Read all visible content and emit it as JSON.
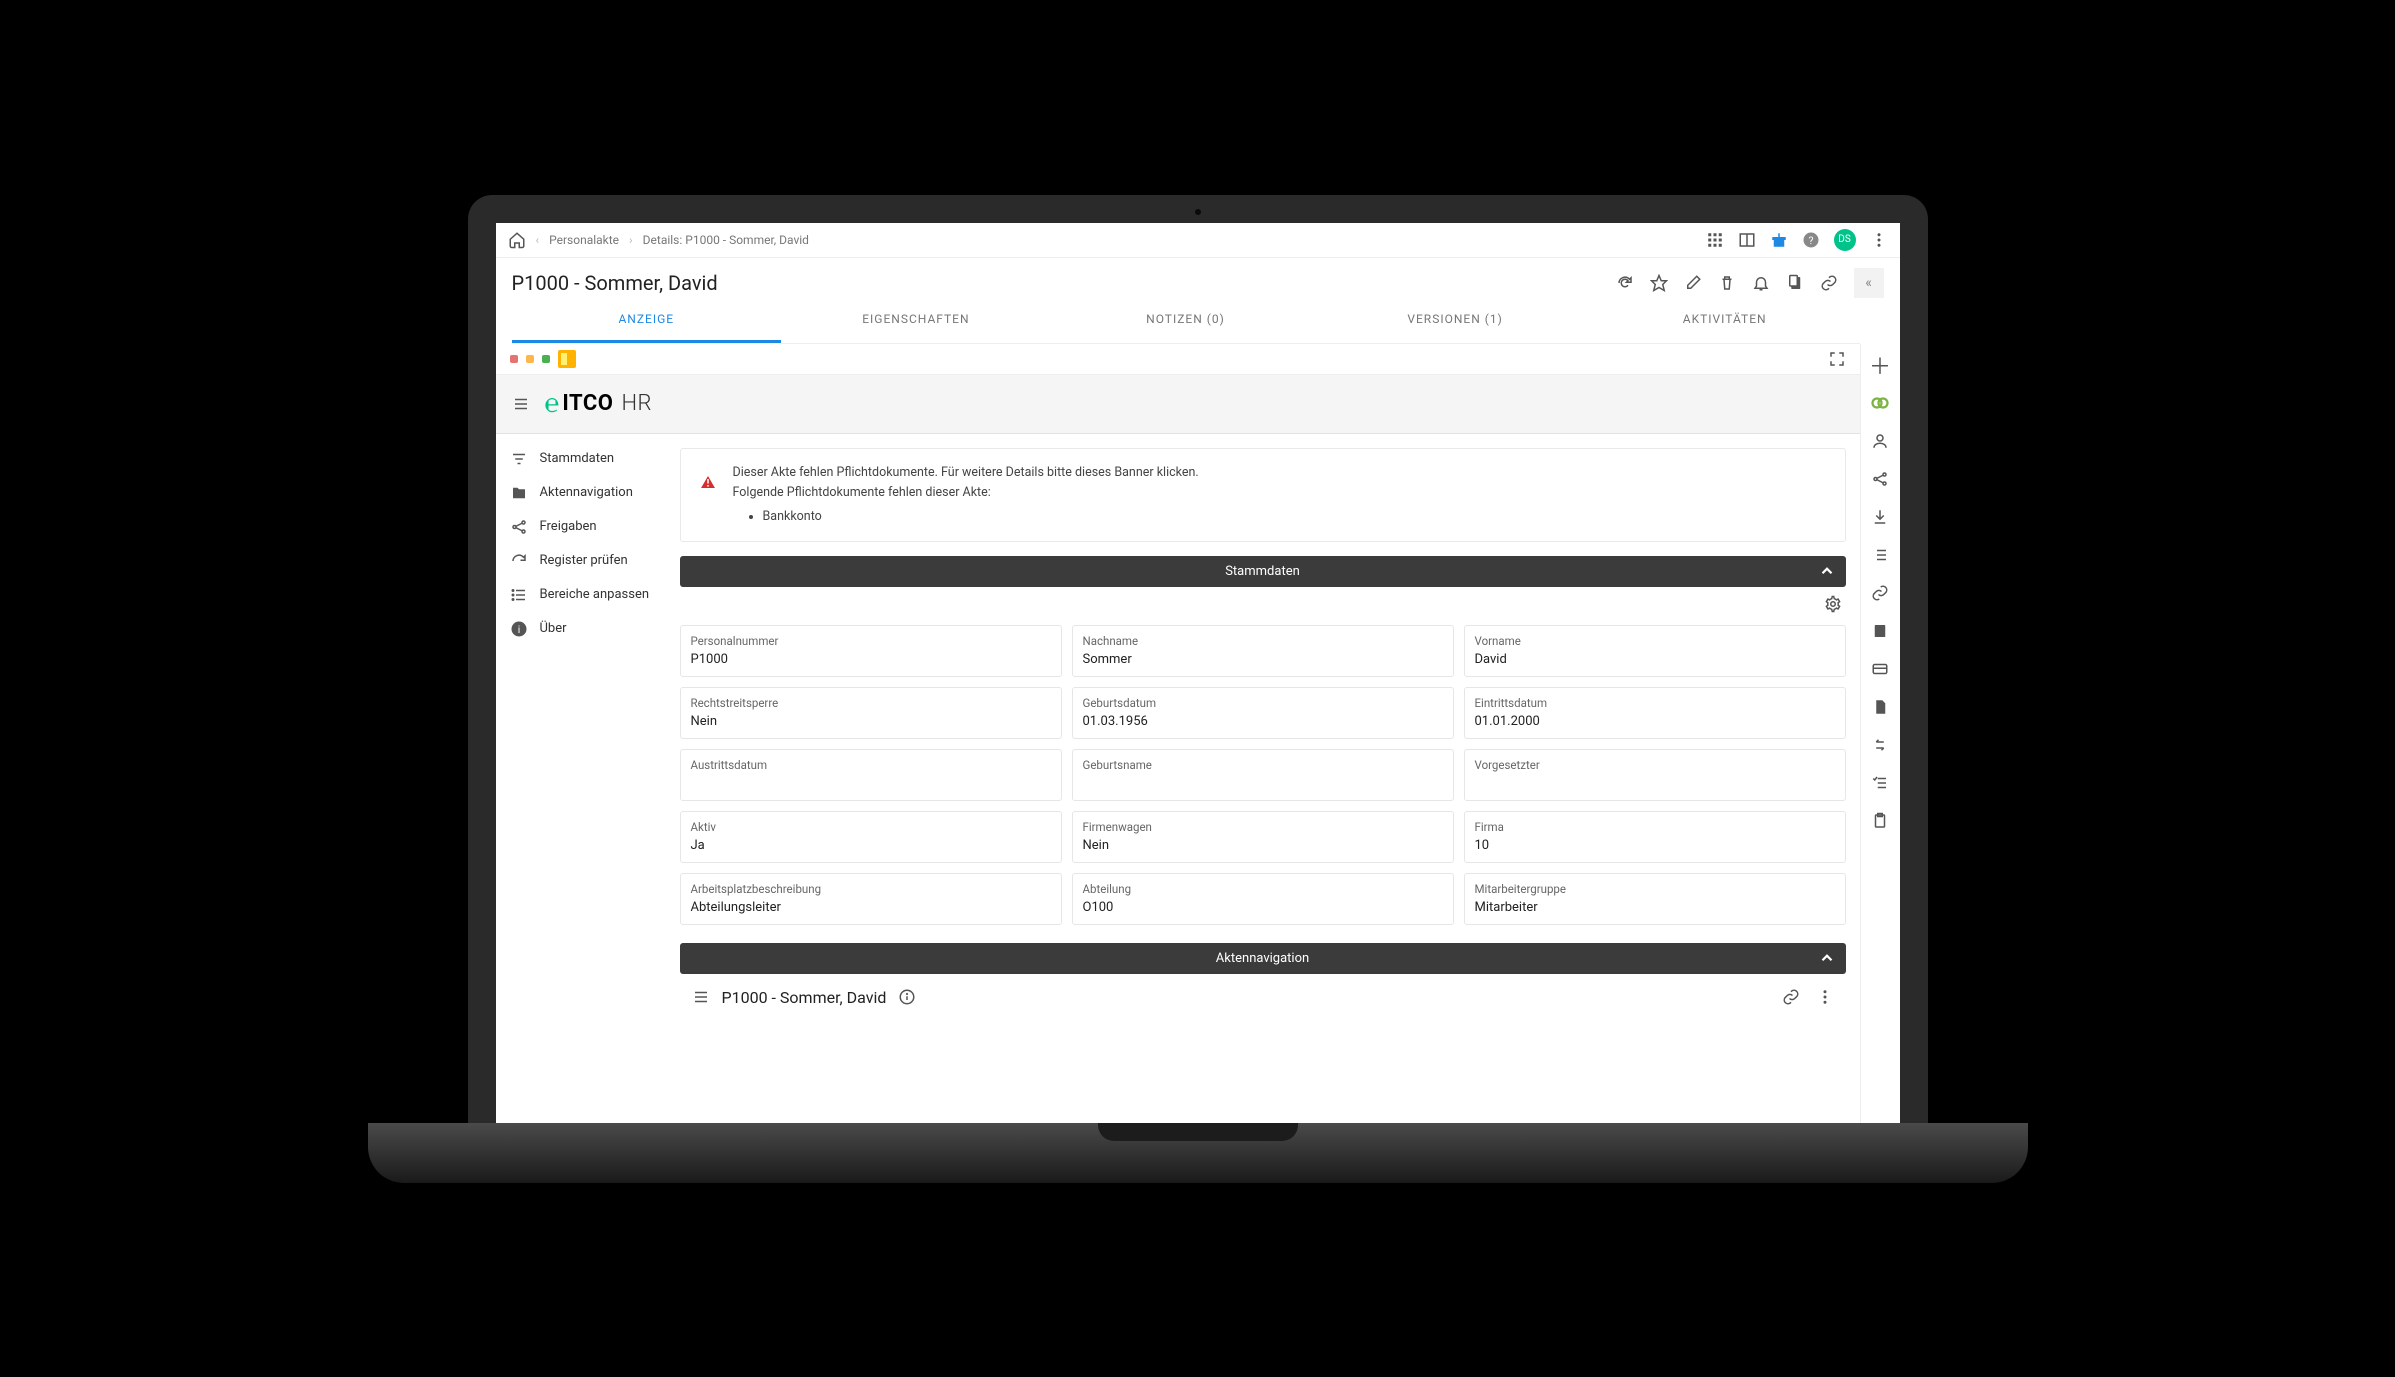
{
  "breadcrumb": {
    "item1": "Personalakte",
    "item2": "Details: P1000 - Sommer, David"
  },
  "header_right": {
    "avatar_initials": "DS"
  },
  "page_title": "P1000 - Sommer, David",
  "tabs": {
    "anzeige": "ANZEIGE",
    "eigenschaften": "EIGENSCHAFTEN",
    "notizen": "NOTIZEN (0)",
    "versionen": "VERSIONEN (1)",
    "aktivitaeten": "AKTIVITÄTEN"
  },
  "logo": {
    "brand": "ITCO",
    "suffix": "HR"
  },
  "sidenav": {
    "stammdaten": "Stammdaten",
    "aktennavigation": "Aktennavigation",
    "freigaben": "Freigaben",
    "register_pruefen": "Register prüfen",
    "bereiche_anpassen": "Bereiche anpassen",
    "ueber": "Über"
  },
  "banner": {
    "line1": "Dieser Akte fehlen Pflichtdokumente. Für weitere Details bitte dieses Banner klicken.",
    "line2": "Folgende Pflichtdokumente fehlen dieser Akte:",
    "missing_item": "Bankkonto"
  },
  "section_stammdaten": "Stammdaten",
  "section_aktennav": "Aktennavigation",
  "fields": {
    "personalnummer": {
      "label": "Personalnummer",
      "value": "P1000"
    },
    "nachname": {
      "label": "Nachname",
      "value": "Sommer"
    },
    "vorname": {
      "label": "Vorname",
      "value": "David"
    },
    "rechtstreitsperre": {
      "label": "Rechtstreitsperre",
      "value": "Nein"
    },
    "geburtsdatum": {
      "label": "Geburtsdatum",
      "value": "01.03.1956"
    },
    "eintrittsdatum": {
      "label": "Eintrittsdatum",
      "value": "01.01.2000"
    },
    "austrittsdatum": {
      "label": "Austrittsdatum",
      "value": ""
    },
    "geburtsname": {
      "label": "Geburtsname",
      "value": ""
    },
    "vorgesetzter": {
      "label": "Vorgesetzter",
      "value": ""
    },
    "aktiv": {
      "label": "Aktiv",
      "value": "Ja"
    },
    "firmenwagen": {
      "label": "Firmenwagen",
      "value": "Nein"
    },
    "firma": {
      "label": "Firma",
      "value": "10"
    },
    "arbeitsplatzbeschreibung": {
      "label": "Arbeitsplatzbeschreibung",
      "value": "Abteilungsleiter"
    },
    "abteilung": {
      "label": "Abteilung",
      "value": "O100"
    },
    "mitarbeitergruppe": {
      "label": "Mitarbeitergruppe",
      "value": "Mitarbeiter"
    }
  },
  "navfile_title": "P1000 - Sommer, David"
}
